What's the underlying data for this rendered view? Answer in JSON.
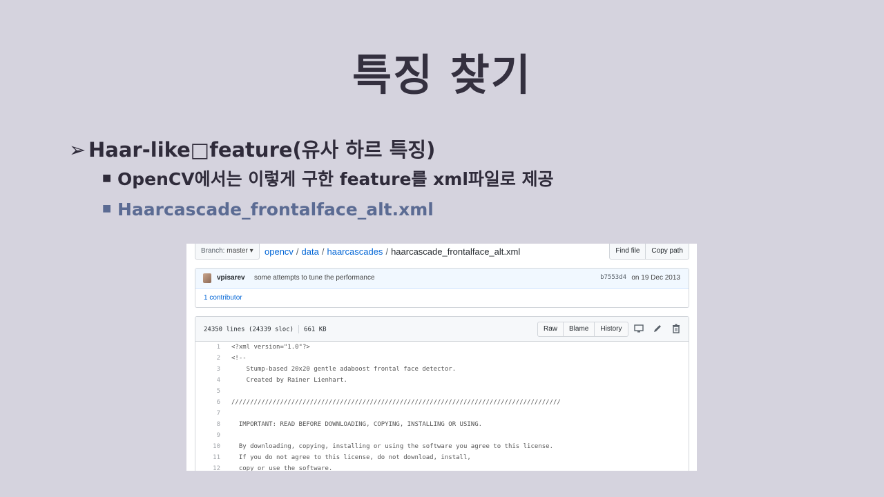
{
  "slide": {
    "title": "특징 찾기",
    "bullet1_marker": "➢",
    "bullet1": "Haar-like□feature(유사  하르  특징)",
    "sub_marker": "■",
    "sub1": "OpenCV에서는  이렇게  구한  feature를  xml파일로  제공",
    "sub2": "Haarcascade_frontalface_alt.xml"
  },
  "github": {
    "branch_label": "Branch:",
    "branch_value": "master",
    "branch_caret": "▾",
    "breadcrumb": [
      "opencv",
      "data",
      "haarcascades"
    ],
    "breadcrumb_sep": "/",
    "filename": "haarcascade_frontalface_alt.xml",
    "find_file": "Find file",
    "copy_path": "Copy path",
    "commit": {
      "author": "vpisarev",
      "message": "some attempts to tune the performance",
      "sha": "b7553d4",
      "date": "on 19 Dec 2013"
    },
    "contributors": "1 contributor",
    "file_lines": "24350 lines (24339 sloc)",
    "file_size": "661 KB",
    "raw": "Raw",
    "blame": "Blame",
    "history": "History",
    "icons": [
      "desktop-icon",
      "pencil-icon",
      "trash-icon"
    ],
    "code": [
      {
        "n": "1",
        "t": "<?xml version=\"1.0\"?>"
      },
      {
        "n": "2",
        "t": "<!--"
      },
      {
        "n": "3",
        "t": "    Stump-based 20x20 gentle adaboost frontal face detector."
      },
      {
        "n": "4",
        "t": "    Created by Rainer Lienhart."
      },
      {
        "n": "5",
        "t": ""
      },
      {
        "n": "6",
        "t": "////////////////////////////////////////////////////////////////////////////////////////"
      },
      {
        "n": "7",
        "t": ""
      },
      {
        "n": "8",
        "t": "  IMPORTANT: READ BEFORE DOWNLOADING, COPYING, INSTALLING OR USING."
      },
      {
        "n": "9",
        "t": ""
      },
      {
        "n": "10",
        "t": "  By downloading, copying, installing or using the software you agree to this license."
      },
      {
        "n": "11",
        "t": "  If you do not agree to this license, do not download, install,"
      },
      {
        "n": "12",
        "t": "  copy or use the software."
      }
    ]
  }
}
